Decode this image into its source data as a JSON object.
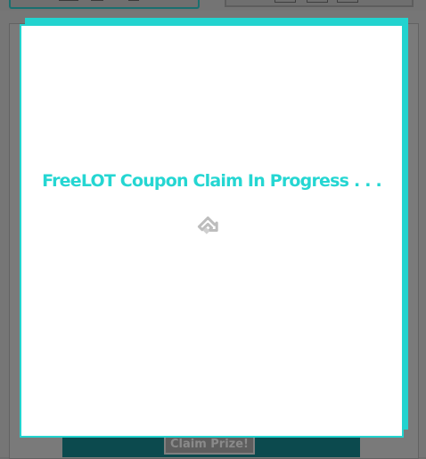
{
  "background": {
    "claim_button_label": "Claim Prize!"
  },
  "modal": {
    "message": "FreeLOT Coupon Claim In Progress . . .",
    "spinner_icon": "loading-spinner-icon"
  },
  "colors": {
    "accent": "#22d3cf",
    "modal_bg": "#ffffff",
    "overlay": "#767676",
    "footer_bar": "#0c4a4e"
  }
}
